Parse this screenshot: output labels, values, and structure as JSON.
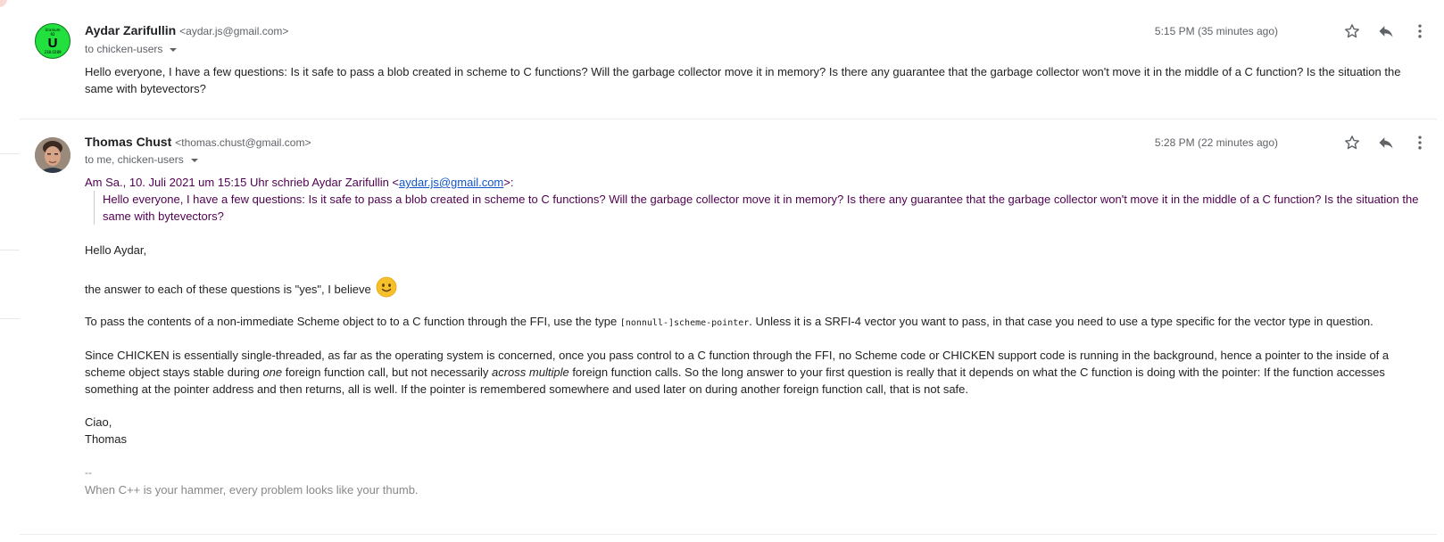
{
  "messages": [
    {
      "sender_name": "Aydar Zarifullin",
      "sender_email": "<aydar.js@gmail.com>",
      "recipients": "to chicken-users",
      "time": "5:15 PM (35 minutes ago)",
      "avatar": {
        "top": "Uranium",
        "num": "92",
        "symbol": "U",
        "mass": "238.0289"
      },
      "body": "Hello everyone, I have a few questions:  Is it safe to pass a blob created in scheme to C functions? Will the garbage collector move it in memory? Is there any guarantee that the garbage collector won't move it in the middle of a C function? Is the situation the same with bytevectors?"
    },
    {
      "sender_name": "Thomas Chust",
      "sender_email": "<thomas.chust@gmail.com>",
      "recipients": "to me, chicken-users",
      "time": "5:28 PM (22 minutes ago)",
      "quote_header_prefix": "Am Sa., 10. Juli 2021 um 15:15 Uhr schrieb Aydar Zarifullin <",
      "quote_header_link": "aydar.js@gmail.com",
      "quote_header_suffix": ">:",
      "quoted_text": "Hello everyone, I have a few questions:  Is it safe to pass a blob created in scheme to C functions? Will the garbage collector move it in memory? Is there any guarantee that the garbage collector won't move it in the middle of a C function? Is the situation the same with bytevectors?",
      "greeting": "Hello Aydar,",
      "answer": "the answer to each of these questions is \"yes\", I believe",
      "ffi_before": "To pass the contents of a non-immediate Scheme object to to a C function through the FFI, use the type ",
      "ffi_code": "[nonnull-]scheme-pointer",
      "ffi_after": ". Unless it is a SRFI-4 vector you want to pass, in that case you need to use a type specific for the vector type in question.",
      "since_1": "Since CHICKEN is essentially single-threaded, as far as the operating system is concerned, once you pass control to a C function through the FFI, no Scheme code or CHICKEN support code is running in the background, hence a pointer to the inside of a scheme object stays stable during ",
      "since_em1": "one",
      "since_2": " foreign function call, but not necessarily ",
      "since_em2": "across multiple",
      "since_3": " foreign function calls. So the long answer to your first question is really that it depends on what the C function is doing with the pointer: If the function accesses something at the pointer address and then returns, all is well. If the pointer is remembered somewhere and used later on during another foreign function call, that is not safe.",
      "closing": "Ciao,",
      "signoff": "Thomas",
      "sig_separator": "--",
      "sig_quote": "When C++ is your hammer, every problem looks like your thumb."
    }
  ],
  "icons": {
    "star": "star-icon",
    "reply": "reply-icon",
    "more": "more-vert-icon",
    "dropdown": "caret-down-icon",
    "emoji": "slightly-smiling-face-icon"
  },
  "colors": {
    "quote": "#500050",
    "link": "#1155cc",
    "signature": "#888888",
    "avatar_element_bg": "#22e03e"
  }
}
